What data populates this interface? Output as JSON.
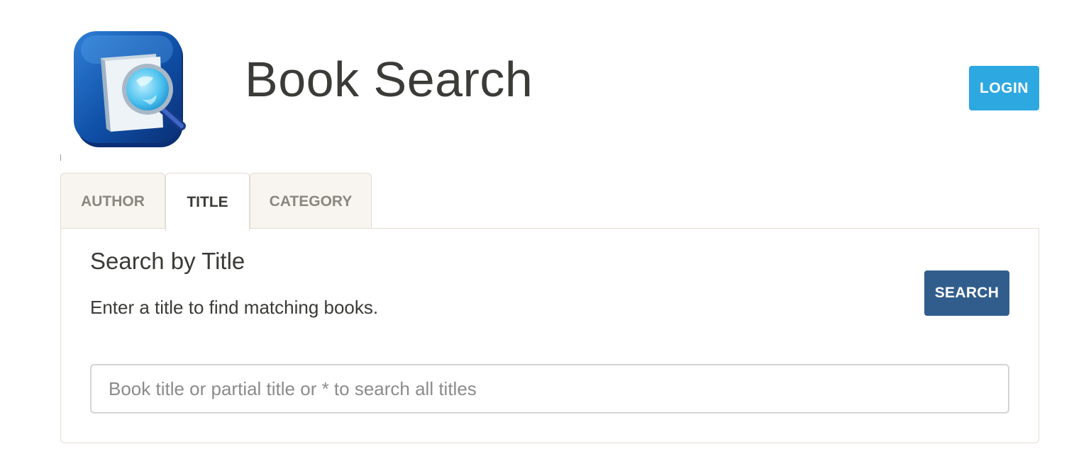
{
  "header": {
    "app_title": "Book Search",
    "logo_icon": "book-magnifier-icon",
    "login_label": "LOGIN"
  },
  "tabs": [
    {
      "label": "AUTHOR",
      "active": false
    },
    {
      "label": "TITLE",
      "active": true
    },
    {
      "label": "CATEGORY",
      "active": false
    }
  ],
  "panel": {
    "heading": "Search by Title",
    "description": "Enter a title to find matching books.",
    "search_label": "SEARCH",
    "input_value": "",
    "input_placeholder": "Book title or partial title or * to search all titles"
  },
  "colors": {
    "login_button": "#2ea8e0",
    "search_button": "#315d8c",
    "tab_background": "#f8f5f0",
    "border": "#e3ddd2"
  }
}
